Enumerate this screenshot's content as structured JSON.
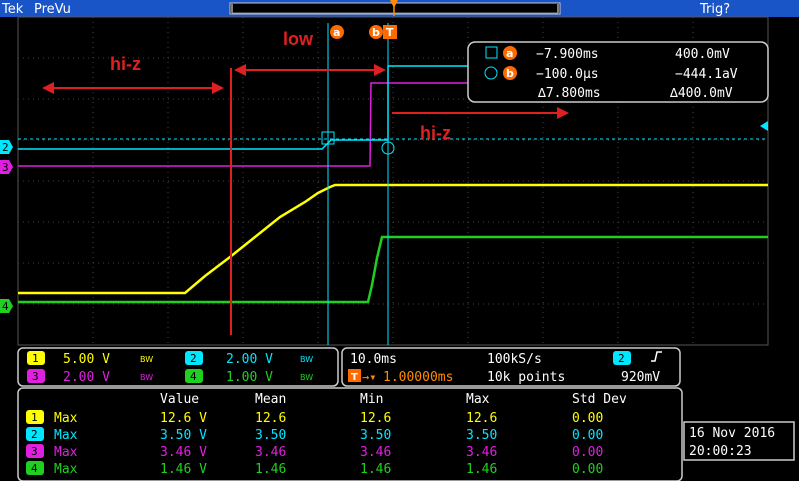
{
  "top_bar": {
    "brand": "Tek",
    "mode": "PreVu",
    "trigger_status": "Trig?"
  },
  "annotations": {
    "hiz_left": "hi-z",
    "low": "low",
    "hiz_right": "hi-z"
  },
  "cursor_badges": {
    "a": "a",
    "b": "b",
    "trigger": "T"
  },
  "cursor_readout": {
    "row_a": {
      "badge": "a",
      "time": "−7.900ms",
      "value": "400.0mV"
    },
    "row_b": {
      "badge": "b",
      "time": "−100.0µs",
      "value": "−444.1aV"
    },
    "row_delta": {
      "time": "∆7.800ms",
      "value": "∆400.0mV"
    }
  },
  "channels": [
    {
      "id": "1",
      "scale": "5.00 V",
      "bw": "BW",
      "color": "#ffff00"
    },
    {
      "id": "2",
      "scale": "2.00 V",
      "bw": "BW",
      "color": "#00e8ff"
    },
    {
      "id": "3",
      "scale": "2.00 V",
      "bw": "BW",
      "color": "#e020e0"
    },
    {
      "id": "4",
      "scale": "1.00 V",
      "bw": "BW",
      "color": "#20d020"
    }
  ],
  "timebase": {
    "scale": "10.0ms",
    "sample_rate": "100kS/s",
    "trigger_channel": "2",
    "trigger_position": "1.00000ms",
    "record_length": "10k points",
    "trigger_level": "920mV"
  },
  "measurements": {
    "headers": [
      "Value",
      "Mean",
      "Min",
      "Max",
      "Std Dev"
    ],
    "rows": [
      {
        "ch": "1",
        "name": "Max",
        "value": "12.6 V",
        "mean": "12.6",
        "min": "12.6",
        "max": "12.6",
        "std": "0.00"
      },
      {
        "ch": "2",
        "name": "Max",
        "value": "3.50 V",
        "mean": "3.50",
        "min": "3.50",
        "max": "3.50",
        "std": "0.00"
      },
      {
        "ch": "3",
        "name": "Max",
        "value": "3.46 V",
        "mean": "3.46",
        "min": "3.46",
        "max": "3.46",
        "std": "0.00"
      },
      {
        "ch": "4",
        "name": "Max",
        "value": "1.46 V",
        "mean": "1.46",
        "min": "1.46",
        "max": "1.46",
        "std": "0.00"
      }
    ]
  },
  "datetime": {
    "date": "16 Nov 2016",
    "time": "20:00:23"
  },
  "colors": {
    "ch1": "#ffff00",
    "ch2": "#00e8ff",
    "ch3": "#e020e0",
    "ch4": "#20d020",
    "annotation": "#e02020",
    "badge": "#ff6a00",
    "topbar": "#1a55c8"
  }
}
